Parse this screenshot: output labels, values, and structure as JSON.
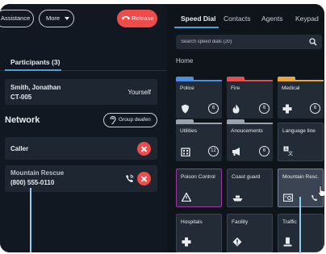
{
  "toolbar": {
    "assistance_label": "Assistance",
    "more_label": "More",
    "release_label": "Release"
  },
  "participants": {
    "tab_label": "Participants (3)",
    "self": {
      "name": "Smith, Jonathan",
      "code": "CT-005",
      "tag": "Yourself"
    }
  },
  "network": {
    "title": "Network",
    "deafen_label": "Group deafen",
    "caller_label": "Caller",
    "rescue": {
      "name": "Mountain Rescue",
      "phone": "(800) 555-0110"
    }
  },
  "right": {
    "tabs": [
      "Speed Dial",
      "Contacts",
      "Agents",
      "Keypad"
    ],
    "search_placeholder": "Search speed dials (20)",
    "breadcrumb": "Home",
    "folders": [
      {
        "label": "Police",
        "count": "6",
        "color": "#4a8fe0",
        "icon": "shield-icon"
      },
      {
        "label": "Fire",
        "count": "6",
        "color": "#e05050",
        "icon": "flame-icon"
      },
      {
        "label": "Medical",
        "count": "6",
        "color": "#e8a53a",
        "icon": "cross-icon"
      },
      {
        "label": "Utilities",
        "count": "12",
        "color": "#9aa3ad",
        "icon": "building-icon"
      },
      {
        "label": "Anoucements",
        "count": "6",
        "color": "#9aa3ad",
        "icon": "megaphone-icon"
      }
    ],
    "tiles": [
      {
        "label": "Language line",
        "icon": "translate-icon"
      },
      {
        "label": "Poison Control",
        "icon": "warning-icon"
      },
      {
        "label": "Coast guard",
        "icon": "boat-icon"
      },
      {
        "label": "Mountain Resc.",
        "icon": "radio-icon"
      },
      {
        "label": "Hospitals",
        "icon": "cross-icon"
      },
      {
        "label": "Facility",
        "icon": "alert-diamond-icon"
      },
      {
        "label": "Traffic",
        "icon": "bollard-icon"
      }
    ]
  },
  "colors": {
    "release": "#ee4b4b",
    "accent": "#4d9fd8",
    "poison": "#9a3aa0"
  }
}
